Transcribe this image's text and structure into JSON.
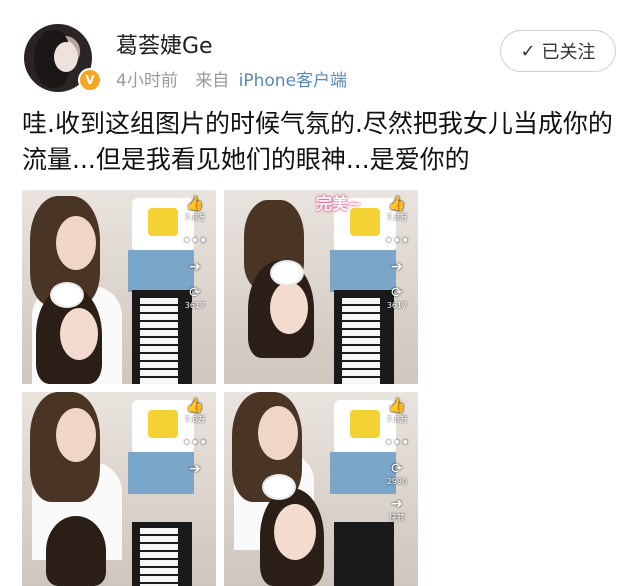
{
  "user": {
    "name": "葛荟婕Ge",
    "time": "4小时前",
    "from_label": "来自",
    "source": "iPhone客户端"
  },
  "follow": {
    "check": "✓",
    "label": "已关注"
  },
  "post": {
    "text": "哇.收到这组图片的时候气氛的.尽然把我女儿当成你的流量...但是我看见她们的眼神...是爱你的"
  },
  "photos": [
    {
      "caption": "",
      "likes": "7.8万",
      "shares": "3617"
    },
    {
      "caption": "完美~",
      "likes": "7.8万",
      "shares": "3617"
    },
    {
      "caption": "",
      "likes": "7.8万",
      "shares": ""
    },
    {
      "caption": "",
      "likes": "7.8万",
      "shares": "2990",
      "share_label": "快转"
    }
  ],
  "colors": {
    "link": "#5b87b8",
    "meta": "#9a9a9a",
    "verified_badge": "#f5a623"
  }
}
